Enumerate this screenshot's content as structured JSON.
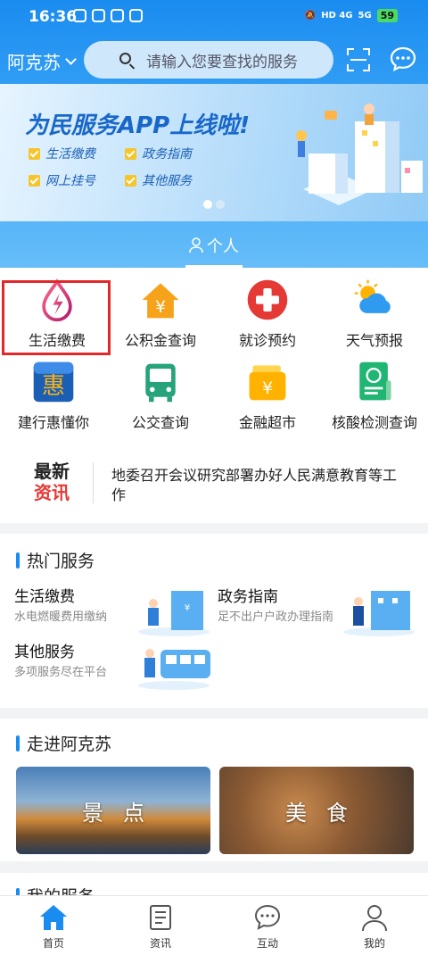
{
  "status": {
    "time": "16:36",
    "net1": "HD 4G",
    "net2": "5G",
    "battery": "59"
  },
  "header": {
    "city": "阿克苏",
    "search_placeholder": "请输入您要查找的服务"
  },
  "banner": {
    "title": "为民服务APP上线啦!",
    "items": [
      "生活缴费",
      "政务指南",
      "网上挂号",
      "其他服务"
    ]
  },
  "tab": {
    "label": "个人"
  },
  "services": [
    {
      "label": "生活缴费",
      "icon": "drop-bolt-icon"
    },
    {
      "label": "公积金查询",
      "icon": "house-yuan-icon"
    },
    {
      "label": "就诊预约",
      "icon": "medical-cross-icon"
    },
    {
      "label": "天气预报",
      "icon": "sun-cloud-icon"
    },
    {
      "label": "建行惠懂你",
      "icon": "hui-icon"
    },
    {
      "label": "公交查询",
      "icon": "bus-icon"
    },
    {
      "label": "金融超市",
      "icon": "wallet-icon"
    },
    {
      "label": "核酸检测查询",
      "icon": "test-report-icon"
    }
  ],
  "news": {
    "tag_line1": "最新",
    "tag_line2": "资讯",
    "headline": "地委召开会议研究部署办好人民满意教育等工作"
  },
  "hot": {
    "title": "热门服务",
    "items": [
      {
        "title": "生活缴费",
        "subtitle": "水电燃暖费用缴纳"
      },
      {
        "title": "政务指南",
        "subtitle": "足不出户户政办理指南"
      },
      {
        "title": "其他服务",
        "subtitle": "多项服务尽在平台"
      }
    ]
  },
  "walk": {
    "title": "走进阿克苏",
    "cards": [
      "景点",
      "美食"
    ]
  },
  "mine": {
    "title": "我的服务"
  },
  "nav": [
    "首页",
    "资讯",
    "互动",
    "我的"
  ],
  "colors": {
    "primary": "#1a8cf0",
    "highlight": "#e02a2a",
    "news_red": "#e53935"
  }
}
